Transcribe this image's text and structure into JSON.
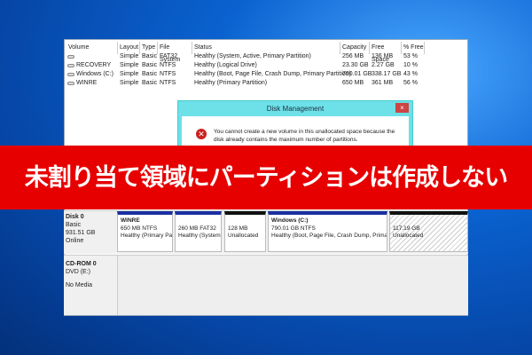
{
  "volume_table": {
    "columns": [
      "Volume",
      "Layout",
      "Type",
      "File System",
      "Status",
      "Capacity",
      "Free Space",
      "% Free"
    ],
    "rows": [
      [
        "",
        "Simple",
        "Basic",
        "FAT32",
        "Healthy (System, Active, Primary Partition)",
        "256 MB",
        "136 MB",
        "53 %"
      ],
      [
        "RECOVERY",
        "Simple",
        "Basic",
        "NTFS",
        "Healthy (Logical Drive)",
        "23.30 GB",
        "2.27 GB",
        "10 %"
      ],
      [
        "Windows (C:)",
        "Simple",
        "Basic",
        "NTFS",
        "Healthy (Boot, Page File, Crash Dump, Primary Partition)",
        "790.01 GB",
        "338.17 GB",
        "43 %"
      ],
      [
        "WINRE",
        "Simple",
        "Basic",
        "NTFS",
        "Healthy (Primary Partition)",
        "650 MB",
        "361 MB",
        "56 %"
      ]
    ]
  },
  "dialog": {
    "title": "Disk Management",
    "close": "×",
    "message": "You cannot create a new volume in this unallocated space because the disk already contains the maximum number of partitions."
  },
  "banner": "未割り当て領域にパーティションは作成しない",
  "disk0": {
    "name": "Disk 0",
    "type": "Basic",
    "size": "931.51 GB",
    "status": "Online",
    "partitions": [
      {
        "name": "WINRE",
        "size": "650 MB NTFS",
        "status": "Healthy (Primary Pa"
      },
      {
        "name": "",
        "size": "260 MB FAT32",
        "status": "Healthy (System,"
      },
      {
        "name": "",
        "size": "128 MB",
        "status": "Unallocated"
      },
      {
        "name": "Windows  (C:)",
        "size": "790.01 GB NTFS",
        "status": "Healthy (Boot, Page File, Crash Dump, Primar"
      },
      {
        "name": "",
        "size": "117.19 GB",
        "status": "Unallocated"
      }
    ]
  },
  "cdrom": {
    "name": "CD-ROM 0",
    "type": "DVD (E:)",
    "status": "No Media"
  }
}
